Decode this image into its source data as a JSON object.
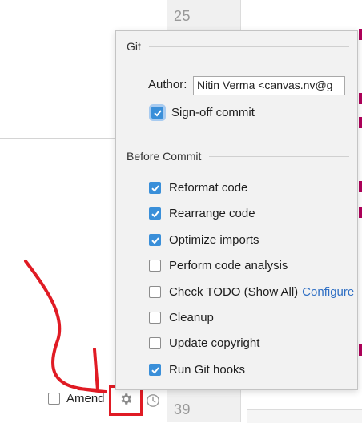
{
  "editor": {
    "line_top": "25",
    "line_bottom": "39"
  },
  "commit_panel": {
    "amend_label": "Amend",
    "amend_checked": false,
    "settings_icon": "gear-icon",
    "history_icon": "clock-icon"
  },
  "popup": {
    "git_section": {
      "title": "Git",
      "author_label": "Author:",
      "author_value": "Nitin Verma <canvas.nv@g",
      "signoff": {
        "label": "Sign-off commit",
        "checked": true
      }
    },
    "before_commit_section": {
      "title": "Before Commit",
      "options": [
        {
          "label": "Reformat code",
          "checked": true
        },
        {
          "label": "Rearrange code",
          "checked": true
        },
        {
          "label": "Optimize imports",
          "checked": true
        },
        {
          "label": "Perform code analysis",
          "checked": false
        },
        {
          "label": "Check TODO (Show All)",
          "checked": false,
          "link": "Configure"
        },
        {
          "label": "Cleanup",
          "checked": false
        },
        {
          "label": "Update copyright",
          "checked": false
        },
        {
          "label": "Run Git hooks",
          "checked": true
        }
      ]
    }
  },
  "colors": {
    "checkbox_checked": "#3a8fd9",
    "link": "#2f6fc4",
    "annotation_red": "#e01b24"
  }
}
